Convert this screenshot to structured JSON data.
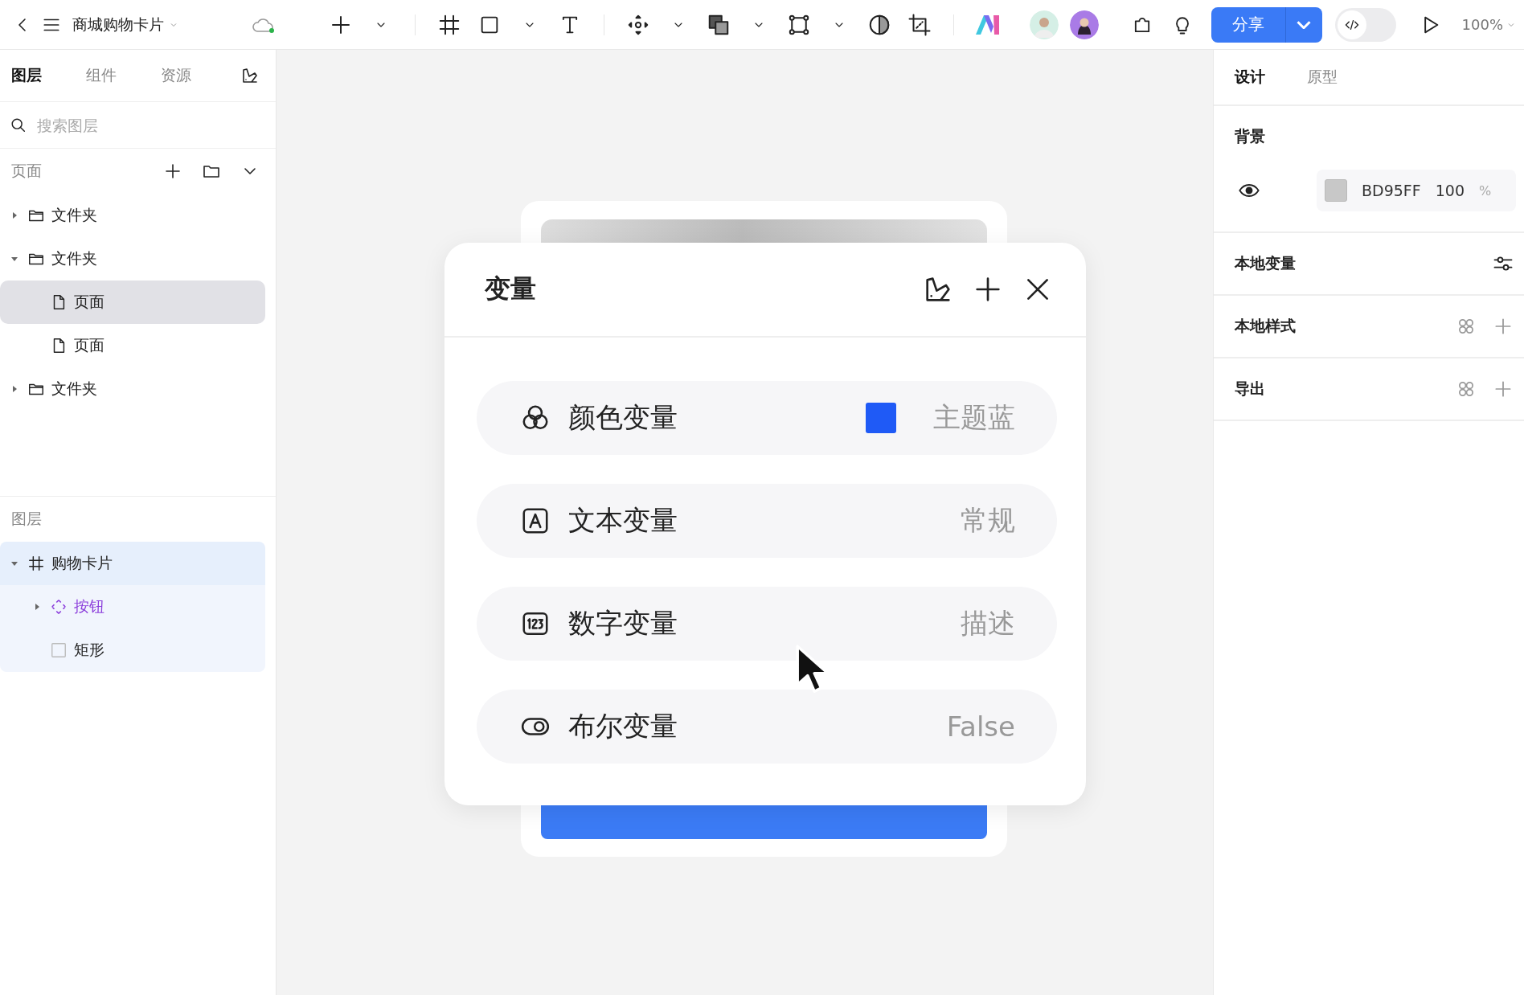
{
  "topbar": {
    "file_title": "商城购物卡片",
    "share_button": "分享",
    "zoom": "100%",
    "code_mode": {
      "on": false
    }
  },
  "left_tabs": [
    {
      "label": "图层",
      "selected": true
    },
    {
      "label": "组件",
      "selected": false
    },
    {
      "label": "资源",
      "selected": false
    }
  ],
  "search": {
    "placeholder": "搜索图层"
  },
  "pages_section": {
    "title": "页面"
  },
  "page_tree": [
    {
      "label": "文件夹",
      "kind": "folder",
      "expanded": false,
      "selected": false
    },
    {
      "label": "文件夹",
      "kind": "folder",
      "expanded": true,
      "selected": false,
      "children": [
        {
          "label": "页面",
          "kind": "page",
          "selected": true
        },
        {
          "label": "页面",
          "kind": "page",
          "selected": false
        }
      ]
    },
    {
      "label": "文件夹",
      "kind": "folder",
      "expanded": false,
      "selected": false
    }
  ],
  "layers_section": {
    "title": "图层"
  },
  "layer_tree": [
    {
      "label": "购物卡片",
      "kind": "frame",
      "expanded": true,
      "selected": true,
      "children": [
        {
          "label": "按钮",
          "kind": "component",
          "expanded": false,
          "selected": false
        },
        {
          "label": "矩形",
          "kind": "rectangle",
          "selected": false
        }
      ]
    }
  ],
  "right_tabs": [
    {
      "label": "设计",
      "selected": true
    },
    {
      "label": "原型",
      "selected": false
    }
  ],
  "background": {
    "title": "背景",
    "hex": "BD95FF",
    "opacity": "100",
    "unit": "%"
  },
  "right_sections": [
    {
      "title": "本地变量",
      "kind": "variables"
    },
    {
      "title": "本地样式",
      "kind": "styles"
    },
    {
      "title": "导出",
      "kind": "export"
    }
  ],
  "dialog": {
    "title": "变量",
    "items": [
      {
        "kind": "color",
        "label": "颜色变量",
        "value": "主题蓝",
        "color": "#1f5af6"
      },
      {
        "kind": "text",
        "label": "文本变量",
        "value": "常规"
      },
      {
        "kind": "number",
        "label": "数字变量",
        "value": "描述"
      },
      {
        "kind": "boolean",
        "label": "布尔变量",
        "value": "False"
      }
    ]
  }
}
